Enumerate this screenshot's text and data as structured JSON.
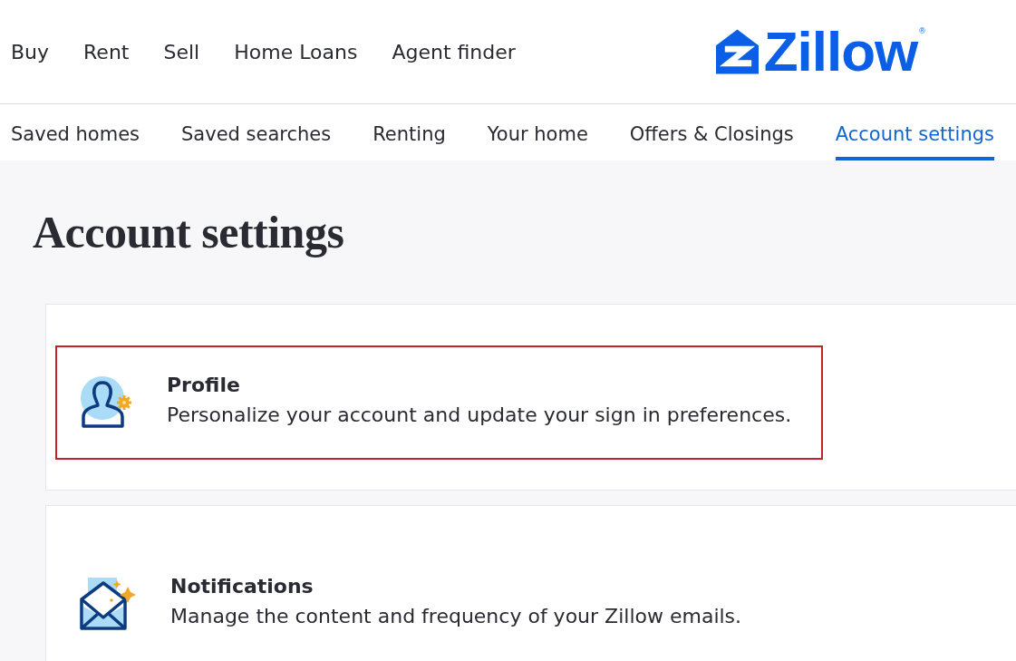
{
  "top_nav": {
    "links": [
      "Buy",
      "Rent",
      "Sell",
      "Home Loans",
      "Agent finder"
    ],
    "logo": {
      "text": "Zillow",
      "mark": "®"
    }
  },
  "tabs": [
    {
      "label": "Saved homes",
      "selected": false
    },
    {
      "label": "Saved searches",
      "selected": false
    },
    {
      "label": "Renting",
      "selected": false
    },
    {
      "label": "Your home",
      "selected": false
    },
    {
      "label": "Offers & Closings",
      "selected": false
    },
    {
      "label": "Account settings",
      "selected": true
    }
  ],
  "page": {
    "title": "Account settings"
  },
  "settings_cards": [
    {
      "kind": "profile",
      "title": "Profile",
      "description": "Personalize your account and update your sign in preferences.",
      "highlighted": true
    },
    {
      "kind": "notifications",
      "title": "Notifications",
      "description": "Manage the content and frequency of your Zillow emails.",
      "highlighted": false
    }
  ]
}
